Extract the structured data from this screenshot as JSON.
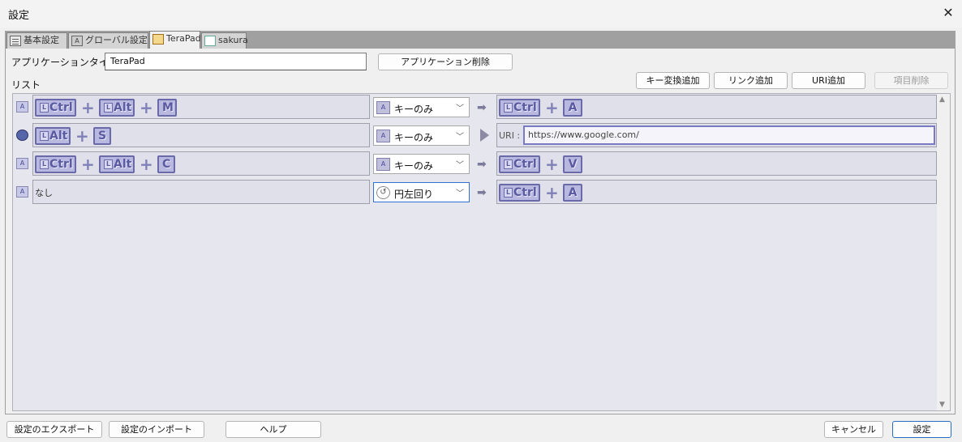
{
  "window": {
    "title": "設定",
    "close_icon": "close-icon"
  },
  "tabs": [
    {
      "label": "基本設定",
      "icon": "document-icon",
      "active": false
    },
    {
      "label": "グローバル設定",
      "icon": "key-a-icon",
      "active": false
    },
    {
      "label": "TeraPad",
      "icon": "terapad-icon",
      "active": true
    },
    {
      "label": "sakura",
      "icon": "sakura-icon",
      "active": false
    }
  ],
  "app": {
    "title_label": "アプリケーションタイトル",
    "title_value": "TeraPad",
    "delete_app_label": "アプリケーション削除"
  },
  "list": {
    "label": "リスト",
    "buttons": {
      "add_key": "キー変換追加",
      "add_link": "リンク追加",
      "add_uri": "URI追加",
      "delete_item": "項目削除"
    },
    "rows": [
      {
        "source_icon": "A",
        "source_keys": [
          "Ctrl",
          "Alt",
          "M"
        ],
        "action": "キーのみ",
        "target_keys": [
          "Ctrl",
          "A"
        ]
      },
      {
        "source_icon": "globe",
        "source_keys": [
          "Alt",
          "S"
        ],
        "action": "キーのみ",
        "uri_label": "URI :",
        "uri_value": "https://www.google.com/"
      },
      {
        "source_icon": "A",
        "source_keys": [
          "Ctrl",
          "Alt",
          "C"
        ],
        "action": "キーのみ",
        "target_keys": [
          "Ctrl",
          "V"
        ]
      },
      {
        "source_icon": "A",
        "source_text": "なし",
        "action": "円左回り",
        "target_keys": [
          "Ctrl",
          "A"
        ]
      }
    ],
    "key_prefix": "L",
    "a_icon_text": "A"
  },
  "footer": {
    "export": "設定のエクスポート",
    "import": "設定のインポート",
    "help": "ヘルプ",
    "cancel": "キャンセル",
    "ok": "設定"
  },
  "colors": {
    "key_face": "#b8b8e0",
    "key_border": "#6a6aa8",
    "list_bg": "#e6e6ee",
    "accent": "#2a6cc2"
  }
}
